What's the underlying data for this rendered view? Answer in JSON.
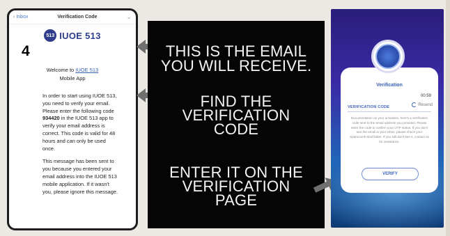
{
  "step_number": "4",
  "left_phone": {
    "back_label": "Inbox",
    "title": "Verification Code",
    "brand_badge": "513",
    "brand_text": "IUOE 513",
    "welcome_line1": "Welcome to ",
    "welcome_link": "IUOE 513",
    "welcome_line2": "Mobile App",
    "paragraph1_before": "In order to start using IUOE 513, you need to verify your email. Please enter the following code ",
    "paragraph1_code": "934420",
    "paragraph1_after": " in the IUOE 513 app to verify your email address is correct. This code is valid for 48 hours and can only be used once.",
    "paragraph2": "This message has been sent to you because you entered your email address into the IUOE 513 mobile application. If it wasn't you, please ignore this message."
  },
  "middle": {
    "line1": "THIS IS THE EMAIL",
    "line2": "YOU WILL RECEIVE.",
    "line3": "FIND THE",
    "line4": "VERIFICATION",
    "line5": "CODE",
    "line6": "ENTER IT ON THE",
    "line7": "VERIFICATION",
    "line8": "PAGE"
  },
  "right_phone": {
    "card_title": "Verification",
    "timer": "00:59",
    "resend": "Resend",
    "code_label": "VERIFICATION CODE",
    "body": "Documentation on your activation, here's a verification code sent to the email address you provided. Please enter the code to confirm your OTP status. If you don't see the email in your inbox, please check your Spam/Junk Mail folder. If you still don't see it, contact us for assistance.",
    "button": "VERIFY"
  },
  "colors": {
    "accent": "#3a61b5",
    "brand": "#2f3d8c",
    "mid_bg": "#050505",
    "arrow": "#6f6f6f"
  }
}
